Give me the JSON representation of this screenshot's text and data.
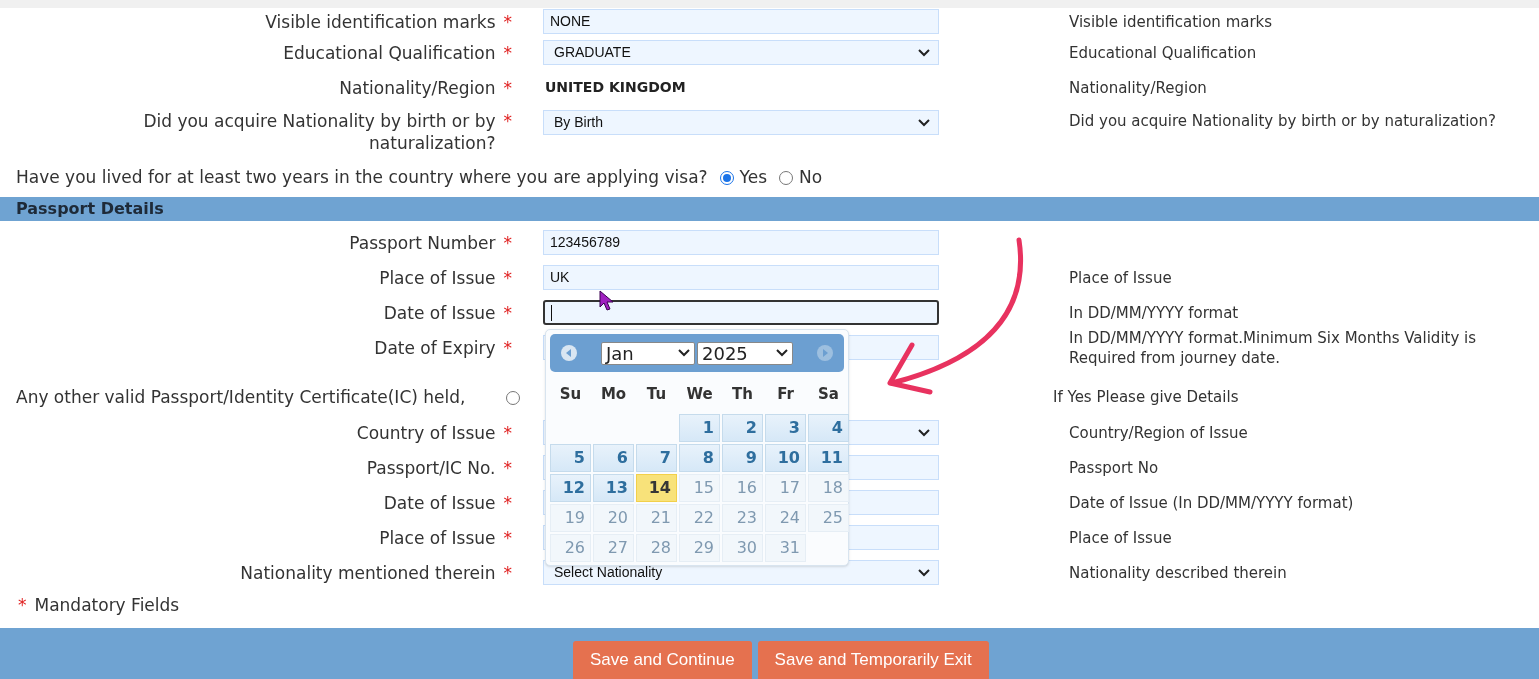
{
  "personal_rows": [
    {
      "label": "Visible identification marks",
      "mark": "*",
      "kind": "text",
      "value": "NONE",
      "hint": "Visible identification marks"
    },
    {
      "label": "Educational Qualification",
      "mark": "*",
      "kind": "select",
      "value": "GRADUATE",
      "hint": "Educational Qualification"
    },
    {
      "label": "Nationality/Region",
      "mark": "*",
      "kind": "static",
      "value": "UNITED KINGDOM",
      "hint": "Nationality/Region"
    },
    {
      "label": "Did you acquire Nationality by birth or by naturalization?",
      "mark": "*",
      "kind": "select",
      "value": "By Birth",
      "hint": "Did you acquire Nationality by birth or by naturalization?"
    }
  ],
  "lived_question": {
    "text": "Have you lived for at least two years in the country where you are applying visa?",
    "options": [
      {
        "label": "Yes",
        "selected": true
      },
      {
        "label": "No",
        "selected": false
      }
    ]
  },
  "section_title": "Passport Details",
  "passport_rows": [
    {
      "label": "Passport Number",
      "mark": "*",
      "kind": "text",
      "value": "123456789",
      "focused": false
    },
    {
      "label": "Place of Issue",
      "mark": "*",
      "kind": "text",
      "value": "UK",
      "hint": "Place of Issue",
      "focused": false
    },
    {
      "label": "Date of Issue",
      "mark": "*",
      "kind": "text",
      "focused": true,
      "hint": "In DD/MM/YYYY format"
    },
    {
      "label": "Date of Expiry",
      "mark": "*",
      "kind": "text",
      "focused": false,
      "hint": "In DD/MM/YYYY format.Minimum Six Months Validity is Required from journey date."
    }
  ],
  "other_passport": {
    "text": "Any other valid Passport/Identity Certificate(IC) held,",
    "selected": false,
    "hint": "If Yes Please give Details"
  },
  "other_rows": [
    {
      "label": "Country of Issue",
      "mark": "*",
      "kind": "select",
      "hint": "Country/Region of Issue"
    },
    {
      "label": "Passport/IC No.",
      "mark": "*",
      "kind": "text",
      "hint": "Passport No"
    },
    {
      "label": "Date of Issue",
      "mark": "*",
      "kind": "text",
      "hint": "Date of Issue (In DD/MM/YYYY format)"
    },
    {
      "label": "Place of Issue",
      "mark": "*",
      "kind": "text",
      "hint": "Place of Issue"
    },
    {
      "label": "Nationality mentioned therein",
      "mark": "*",
      "kind": "select",
      "value": "Select Nationality",
      "hint": "Nationality described therein"
    }
  ],
  "mandatory_note": {
    "mark": "*",
    "text": "Mandatory Fields"
  },
  "calendar": {
    "month": "Jan",
    "year": "2025",
    "weekdays": [
      "Su",
      "Mo",
      "Tu",
      "We",
      "Th",
      "Fr",
      "Sa"
    ],
    "weeks": [
      {
        "days": [
          {
            "day": "1",
            "today": false,
            "disabled": false
          },
          {
            "day": "2",
            "today": false,
            "disabled": false
          },
          {
            "day": "3",
            "today": false,
            "disabled": false
          },
          {
            "day": "4",
            "today": false,
            "disabled": false
          }
        ]
      },
      {
        "days": [
          {
            "day": "5",
            "today": false,
            "disabled": false
          },
          {
            "day": "6",
            "today": false,
            "disabled": false
          },
          {
            "day": "7",
            "today": false,
            "disabled": false
          },
          {
            "day": "8",
            "today": false,
            "disabled": false
          },
          {
            "day": "9",
            "today": false,
            "disabled": false
          },
          {
            "day": "10",
            "today": false,
            "disabled": false
          },
          {
            "day": "11",
            "today": false,
            "disabled": false
          }
        ]
      },
      {
        "days": [
          {
            "day": "12",
            "today": false,
            "disabled": false
          },
          {
            "day": "13",
            "today": false,
            "disabled": false
          },
          {
            "day": "14",
            "today": true,
            "disabled": false
          },
          {
            "day": "15",
            "today": false,
            "disabled": true
          },
          {
            "day": "16",
            "today": false,
            "disabled": true
          },
          {
            "day": "17",
            "today": false,
            "disabled": true
          },
          {
            "day": "18",
            "today": false,
            "disabled": true
          }
        ]
      },
      {
        "days": [
          {
            "day": "19",
            "today": false,
            "disabled": true
          },
          {
            "day": "20",
            "today": false,
            "disabled": true
          },
          {
            "day": "21",
            "today": false,
            "disabled": true
          },
          {
            "day": "22",
            "today": false,
            "disabled": true
          },
          {
            "day": "23",
            "today": false,
            "disabled": true
          },
          {
            "day": "24",
            "today": false,
            "disabled": true
          },
          {
            "day": "25",
            "today": false,
            "disabled": true
          }
        ]
      },
      {
        "days": [
          {
            "day": "26",
            "today": false,
            "disabled": true
          },
          {
            "day": "27",
            "today": false,
            "disabled": true
          },
          {
            "day": "28",
            "today": false,
            "disabled": true
          },
          {
            "day": "29",
            "today": false,
            "disabled": true
          },
          {
            "day": "30",
            "today": false,
            "disabled": true
          },
          {
            "day": "31",
            "today": false,
            "disabled": true
          }
        ]
      }
    ]
  },
  "buttons": [
    "Save and Continue",
    "Save and Temporarily Exit"
  ]
}
